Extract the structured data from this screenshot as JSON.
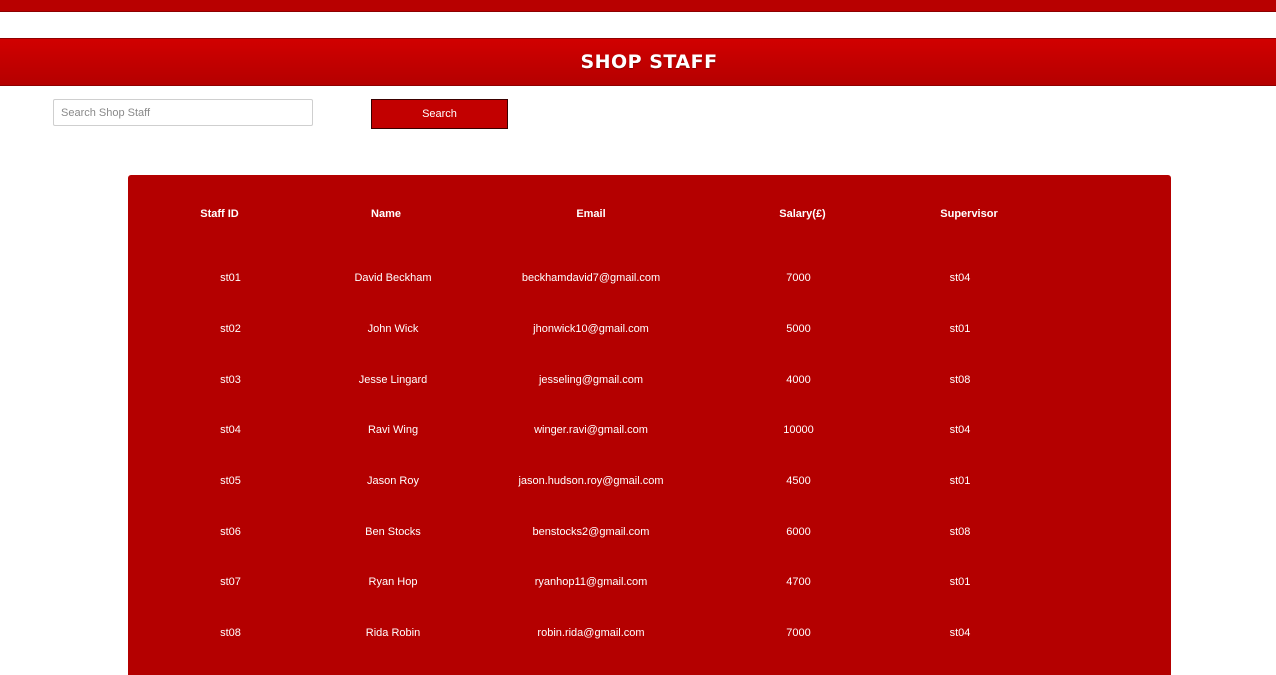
{
  "header": {
    "title": "SHOP STAFF"
  },
  "search": {
    "placeholder": "Search Shop Staff",
    "value": "",
    "button_label": "Search"
  },
  "table": {
    "columns": [
      "Staff ID",
      "Name",
      "Email",
      "Salary(£)",
      "Supervisor"
    ],
    "rows": [
      [
        "st01",
        "David Beckham",
        "beckhamdavid7@gmail.com",
        "7000",
        "st04"
      ],
      [
        "st02",
        "John Wick",
        "jhonwick10@gmail.com",
        "5000",
        "st01"
      ],
      [
        "st03",
        "Jesse Lingard",
        "jesseling@gmail.com",
        "4000",
        "st08"
      ],
      [
        "st04",
        "Ravi Wing",
        "winger.ravi@gmail.com",
        "10000",
        "st04"
      ],
      [
        "st05",
        "Jason Roy",
        "jason.hudson.roy@gmail.com",
        "4500",
        "st01"
      ],
      [
        "st06",
        "Ben Stocks",
        "benstocks2@gmail.com",
        "6000",
        "st08"
      ],
      [
        "st07",
        "Ryan Hop",
        "ryanhop11@gmail.com",
        "4700",
        "st01"
      ],
      [
        "st08",
        "Rida Robin",
        "robin.rida@gmail.com",
        "7000",
        "st04"
      ]
    ]
  },
  "colors": {
    "brand_red": "#c20000",
    "panel_red": "#b40000",
    "text_on_red": "#ffffff"
  }
}
